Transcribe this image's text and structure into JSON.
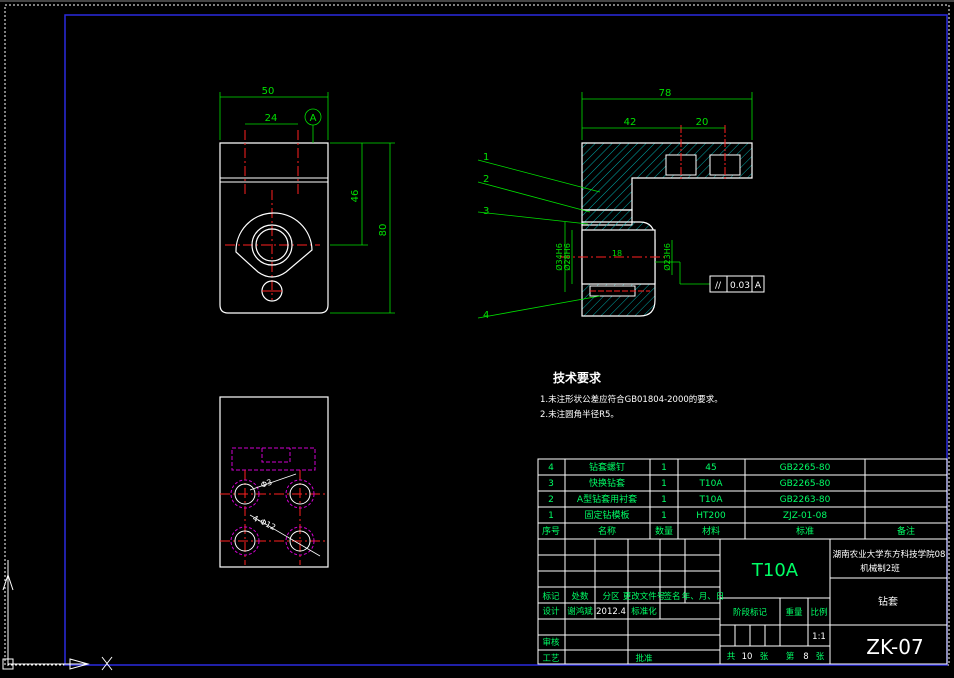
{
  "colors": {
    "background": "#000000",
    "frame": "#2a2adf",
    "outline": "#ffffff",
    "center": "#ff2020",
    "dimension": "#00e000",
    "hatch": "#00a8a8",
    "hidden": "#d000d0",
    "table_text": "#00ff66",
    "table_line": "#ffffff"
  },
  "front_view": {
    "dim_width": "50",
    "dim_hole_spacing": "24",
    "datum": "A",
    "dim_center_height": "46",
    "dim_height": "80"
  },
  "section_view": {
    "dim_length": "78",
    "dim_42": "42",
    "dim_20": "20",
    "dia_outer": "Ø34H6",
    "dia_bore": "Ø28H6",
    "dia_23": "Ø23H6",
    "dim_18": "18",
    "balloons": [
      "1",
      "2",
      "3",
      "4"
    ],
    "tolerance_symbol": "//",
    "tolerance_value": "0.03",
    "tolerance_datum": "A"
  },
  "bottom_view": {
    "dim_hole_spacing": "Φ3",
    "dim_holes": "4-Φ12"
  },
  "tech_requirements": {
    "title": "技术要求",
    "items": [
      "1.未注形状公差应符合GB01804-2000的要求。",
      "2.未注圆角半径R5。"
    ]
  },
  "parts_list": {
    "rows": [
      {
        "no": "4",
        "name": "钻套螺钉",
        "qty": "1",
        "material": "45",
        "standard": "GB2265-80",
        "remark": ""
      },
      {
        "no": "3",
        "name": "快换钻套",
        "qty": "1",
        "material": "T10A",
        "standard": "GB2265-80",
        "remark": ""
      },
      {
        "no": "2",
        "name": "A型钻套用衬套",
        "qty": "1",
        "material": "T10A",
        "standard": "GB2263-80",
        "remark": ""
      },
      {
        "no": "1",
        "name": "固定钻模板",
        "qty": "1",
        "material": "HT200",
        "standard": "ZJZ-01-08",
        "remark": ""
      }
    ],
    "headers": {
      "no": "序号",
      "name": "名称",
      "qty": "数量",
      "material": "材料",
      "standard": "标准",
      "remark": "备注"
    }
  },
  "title_block": {
    "material": "T10A",
    "school_line1": "湖南农业大学东方科技学院08",
    "school_line2": "机械制2班",
    "drawing_name": "钻套",
    "drawing_no": "ZK-07",
    "label_mark": "标记",
    "label_count": "处数",
    "label_zone": "分区",
    "label_change_doc": "更改文件号",
    "label_sign": "签名",
    "label_date": "年、月、日",
    "label_design": "设计",
    "designer": "谢鸿斌",
    "design_date": "2012.4",
    "label_std": "标准化",
    "label_stage": "阶段标记",
    "label_weight": "重量",
    "label_scale": "比例",
    "scale": "1:1",
    "label_review": "审核",
    "label_process": "工艺",
    "label_approve": "批准",
    "sheets_total_prefix": "共",
    "sheets_total": "10",
    "sheets_unit1": "张",
    "sheet_prefix": "第",
    "sheet_no": "8",
    "sheets_unit2": "张"
  }
}
